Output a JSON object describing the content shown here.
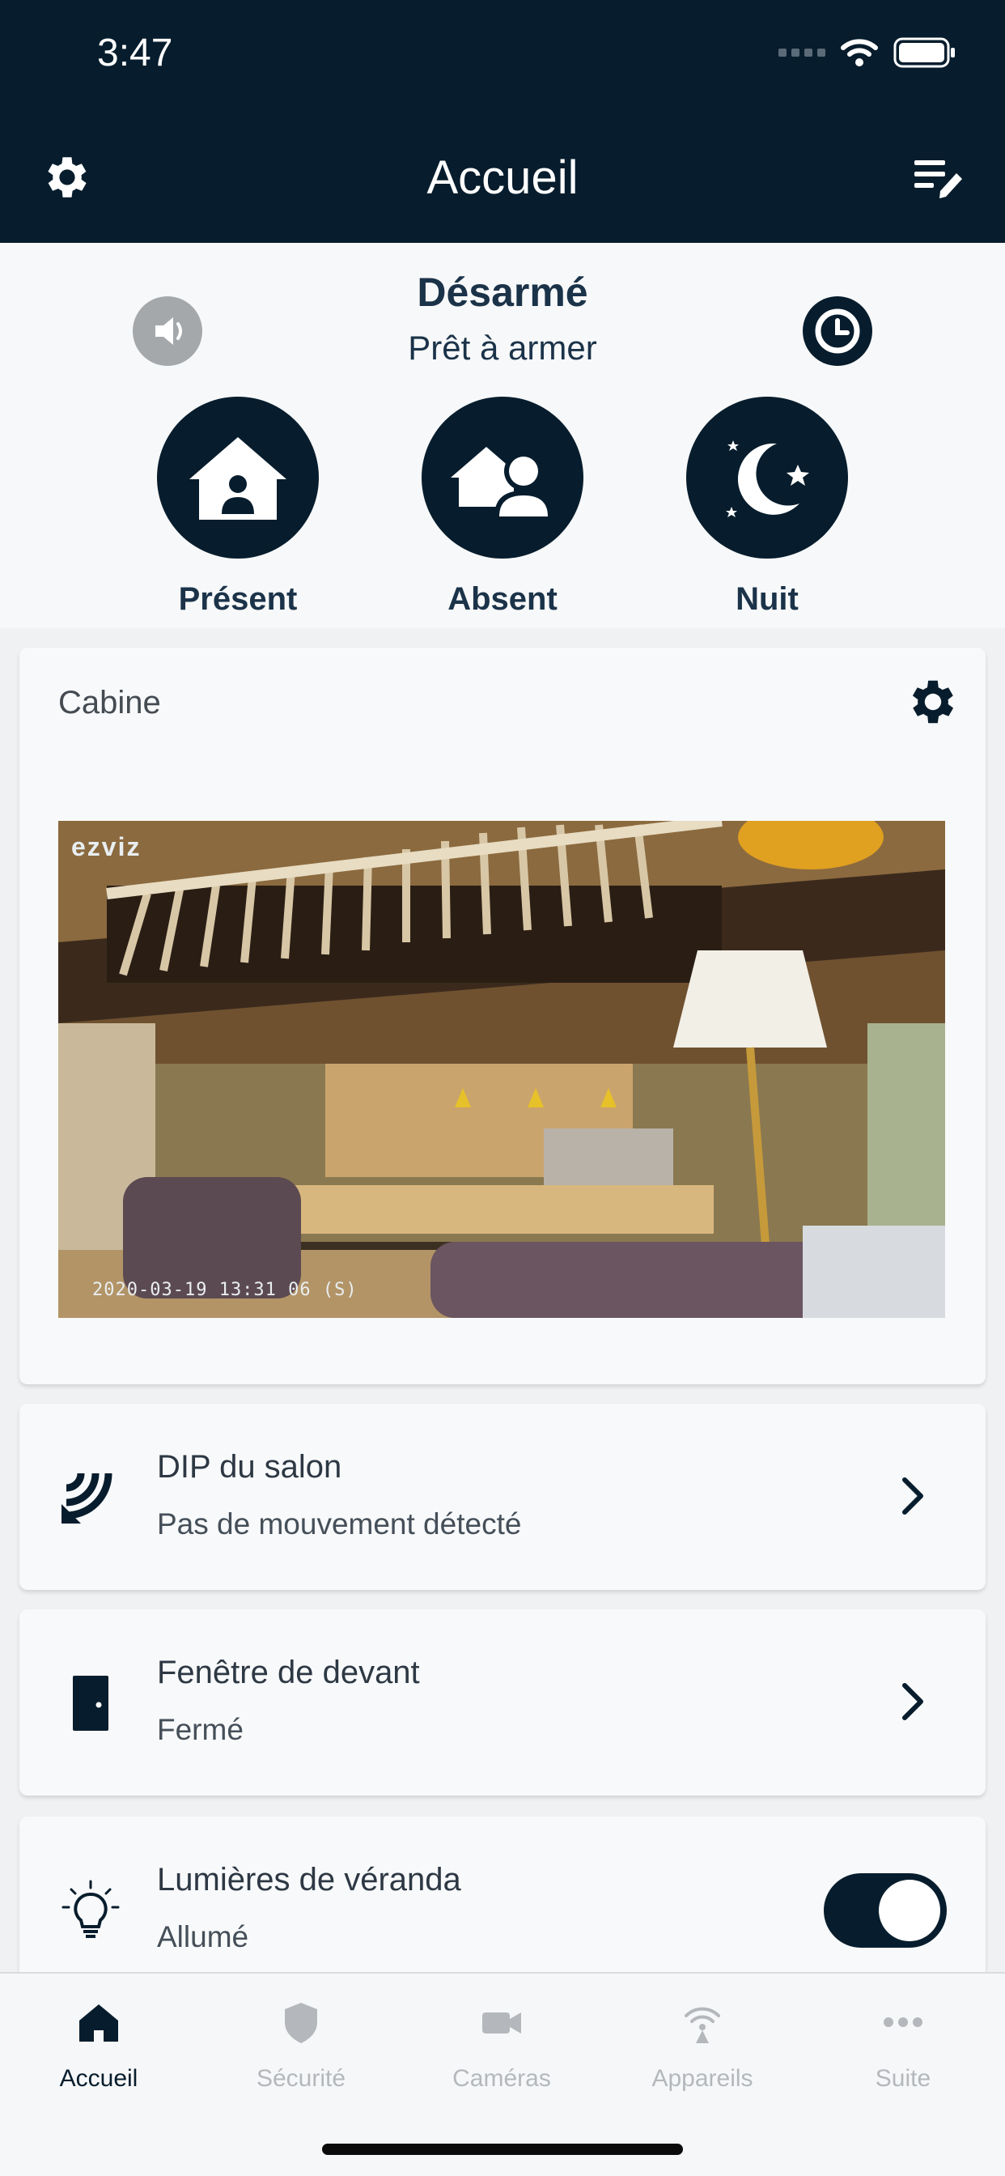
{
  "status_bar": {
    "time": "3:47"
  },
  "header": {
    "title": "Accueil",
    "left_icon": "gear-icon",
    "right_icon": "edit-list-icon"
  },
  "arm_panel": {
    "status": "Désarmé",
    "substatus": "Prêt à armer",
    "left_button_icon": "speaker-icon",
    "right_button_icon": "clock-icon",
    "modes": [
      {
        "label": "Présent",
        "icon": "home-person-icon"
      },
      {
        "label": "Absent",
        "icon": "away-person-icon"
      },
      {
        "label": "Nuit",
        "icon": "moon-stars-icon"
      }
    ]
  },
  "camera_card": {
    "title": "Cabine",
    "settings_icon": "gear-icon",
    "feed_brand": "ezviz",
    "feed_timestamp": "2020-03-19 13:31 06 (S)"
  },
  "devices": [
    {
      "name": "DIP du salon",
      "status": "Pas de mouvement détecté",
      "icon": "motion-sensor-icon",
      "action": "chevron-right-icon"
    },
    {
      "name": "Fenêtre de devant",
      "status": "Fermé",
      "icon": "door-icon",
      "action": "chevron-right-icon"
    },
    {
      "name": "Lumières de véranda",
      "status": "Allumé",
      "icon": "lightbulb-icon",
      "action": "toggle",
      "toggle_on": true
    }
  ],
  "tabbar": {
    "items": [
      {
        "label": "Accueil",
        "icon": "home-icon",
        "active": true
      },
      {
        "label": "Sécurité",
        "icon": "shield-icon",
        "active": false
      },
      {
        "label": "Caméras",
        "icon": "camera-icon",
        "active": false
      },
      {
        "label": "Appareils",
        "icon": "wireless-device-icon",
        "active": false
      },
      {
        "label": "Suite",
        "icon": "more-icon",
        "active": false
      }
    ]
  },
  "colors": {
    "navy": "#071d2d",
    "panel_bg": "#f7f8f9",
    "inactive_tab": "#b4b8bc",
    "speaker_gray": "#a5a8ab"
  }
}
